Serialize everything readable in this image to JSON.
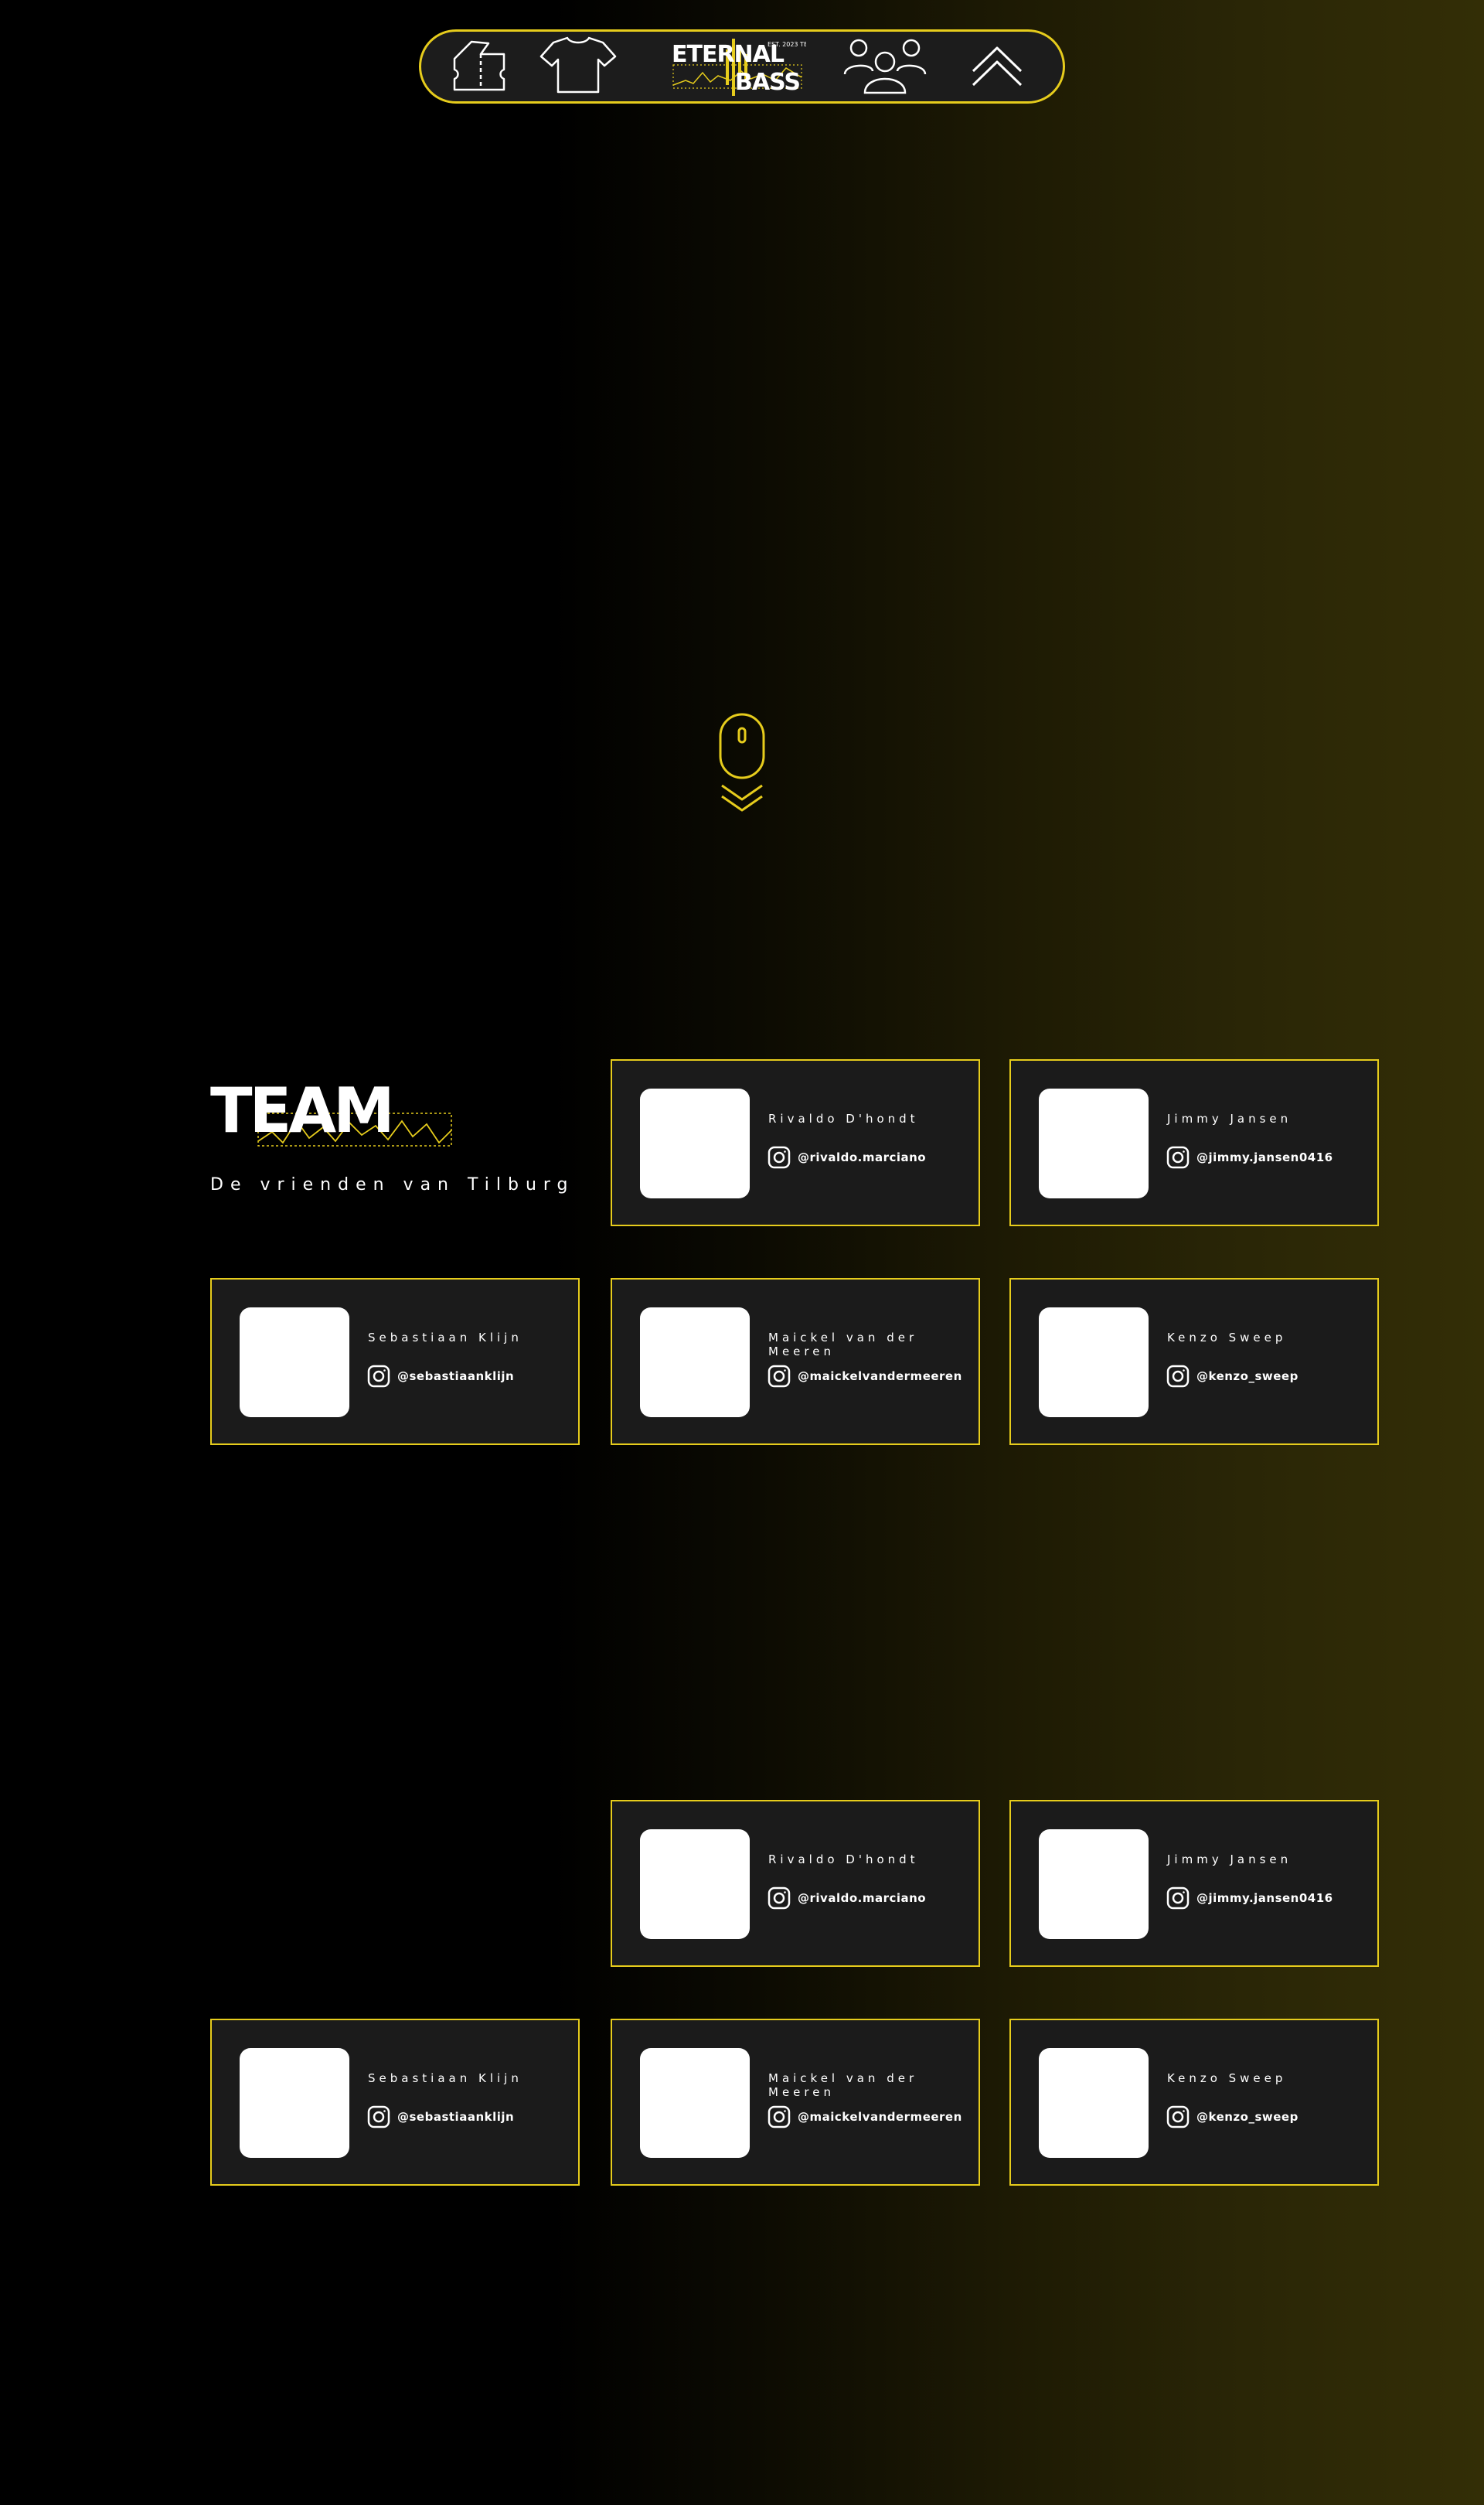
{
  "nav": {
    "items": [
      {
        "icon": "ticket-icon"
      },
      {
        "icon": "tshirt-icon"
      },
      {
        "icon": "eternal-bass-logo"
      },
      {
        "icon": "team-icon"
      },
      {
        "icon": "chevron-up-icon"
      }
    ],
    "logo": {
      "line1": "ETERNAL",
      "line2": "BASS",
      "est": "EST. 2023 TB"
    }
  },
  "scroll_indicator": {
    "icon": "mouse-scroll-icon"
  },
  "team": {
    "title": "TEAM",
    "subtitle": "De vrienden van Tilburg"
  },
  "team_sections": [
    {
      "members": [
        {
          "name": "Rivaldo D'hondt",
          "handle": "@rivaldo.marciano"
        },
        {
          "name": "Jimmy Jansen",
          "handle": "@jimmy.jansen0416"
        },
        {
          "name": "Sebastiaan Klijn",
          "handle": "@sebastiaanklijn"
        },
        {
          "name": "Maickel van der Meeren",
          "handle": "@maickelvandermeeren"
        },
        {
          "name": "Kenzo Sweep",
          "handle": "@kenzo_sweep"
        }
      ]
    },
    {
      "members": [
        {
          "name": "Rivaldo D'hondt",
          "handle": "@rivaldo.marciano"
        },
        {
          "name": "Jimmy Jansen",
          "handle": "@jimmy.jansen0416"
        },
        {
          "name": "Sebastiaan Klijn",
          "handle": "@sebastiaanklijn"
        },
        {
          "name": "Maickel van der Meeren",
          "handle": "@maickelvandermeeren"
        },
        {
          "name": "Kenzo Sweep",
          "handle": "@kenzo_sweep"
        }
      ]
    }
  ],
  "colors": {
    "accent": "#e6cc1c",
    "background": "#000000",
    "card": "#1b1b1b",
    "text": "#ffffff"
  }
}
